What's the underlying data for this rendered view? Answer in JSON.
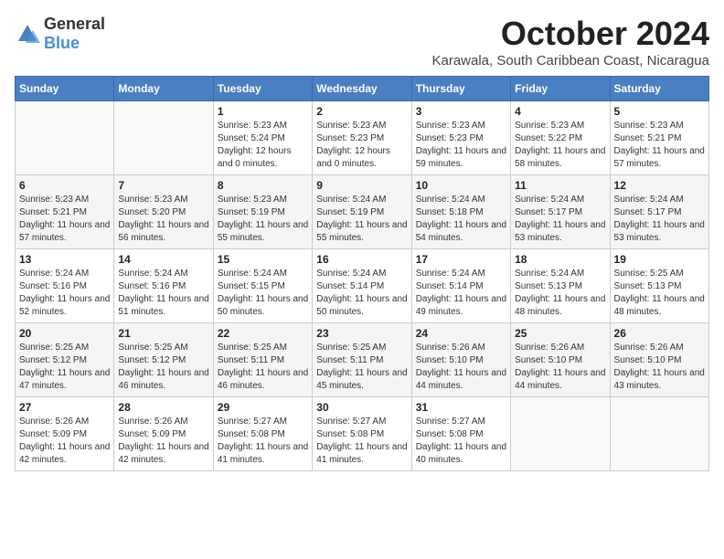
{
  "logo": {
    "general": "General",
    "blue": "Blue"
  },
  "title": "October 2024",
  "location": "Karawala, South Caribbean Coast, Nicaragua",
  "weekdays": [
    "Sunday",
    "Monday",
    "Tuesday",
    "Wednesday",
    "Thursday",
    "Friday",
    "Saturday"
  ],
  "weeks": [
    [
      {
        "day": "",
        "sunrise": "",
        "sunset": "",
        "daylight": ""
      },
      {
        "day": "",
        "sunrise": "",
        "sunset": "",
        "daylight": ""
      },
      {
        "day": "1",
        "sunrise": "Sunrise: 5:23 AM",
        "sunset": "Sunset: 5:24 PM",
        "daylight": "Daylight: 12 hours and 0 minutes."
      },
      {
        "day": "2",
        "sunrise": "Sunrise: 5:23 AM",
        "sunset": "Sunset: 5:23 PM",
        "daylight": "Daylight: 12 hours and 0 minutes."
      },
      {
        "day": "3",
        "sunrise": "Sunrise: 5:23 AM",
        "sunset": "Sunset: 5:23 PM",
        "daylight": "Daylight: 11 hours and 59 minutes."
      },
      {
        "day": "4",
        "sunrise": "Sunrise: 5:23 AM",
        "sunset": "Sunset: 5:22 PM",
        "daylight": "Daylight: 11 hours and 58 minutes."
      },
      {
        "day": "5",
        "sunrise": "Sunrise: 5:23 AM",
        "sunset": "Sunset: 5:21 PM",
        "daylight": "Daylight: 11 hours and 57 minutes."
      }
    ],
    [
      {
        "day": "6",
        "sunrise": "Sunrise: 5:23 AM",
        "sunset": "Sunset: 5:21 PM",
        "daylight": "Daylight: 11 hours and 57 minutes."
      },
      {
        "day": "7",
        "sunrise": "Sunrise: 5:23 AM",
        "sunset": "Sunset: 5:20 PM",
        "daylight": "Daylight: 11 hours and 56 minutes."
      },
      {
        "day": "8",
        "sunrise": "Sunrise: 5:23 AM",
        "sunset": "Sunset: 5:19 PM",
        "daylight": "Daylight: 11 hours and 55 minutes."
      },
      {
        "day": "9",
        "sunrise": "Sunrise: 5:24 AM",
        "sunset": "Sunset: 5:19 PM",
        "daylight": "Daylight: 11 hours and 55 minutes."
      },
      {
        "day": "10",
        "sunrise": "Sunrise: 5:24 AM",
        "sunset": "Sunset: 5:18 PM",
        "daylight": "Daylight: 11 hours and 54 minutes."
      },
      {
        "day": "11",
        "sunrise": "Sunrise: 5:24 AM",
        "sunset": "Sunset: 5:17 PM",
        "daylight": "Daylight: 11 hours and 53 minutes."
      },
      {
        "day": "12",
        "sunrise": "Sunrise: 5:24 AM",
        "sunset": "Sunset: 5:17 PM",
        "daylight": "Daylight: 11 hours and 53 minutes."
      }
    ],
    [
      {
        "day": "13",
        "sunrise": "Sunrise: 5:24 AM",
        "sunset": "Sunset: 5:16 PM",
        "daylight": "Daylight: 11 hours and 52 minutes."
      },
      {
        "day": "14",
        "sunrise": "Sunrise: 5:24 AM",
        "sunset": "Sunset: 5:16 PM",
        "daylight": "Daylight: 11 hours and 51 minutes."
      },
      {
        "day": "15",
        "sunrise": "Sunrise: 5:24 AM",
        "sunset": "Sunset: 5:15 PM",
        "daylight": "Daylight: 11 hours and 50 minutes."
      },
      {
        "day": "16",
        "sunrise": "Sunrise: 5:24 AM",
        "sunset": "Sunset: 5:14 PM",
        "daylight": "Daylight: 11 hours and 50 minutes."
      },
      {
        "day": "17",
        "sunrise": "Sunrise: 5:24 AM",
        "sunset": "Sunset: 5:14 PM",
        "daylight": "Daylight: 11 hours and 49 minutes."
      },
      {
        "day": "18",
        "sunrise": "Sunrise: 5:24 AM",
        "sunset": "Sunset: 5:13 PM",
        "daylight": "Daylight: 11 hours and 48 minutes."
      },
      {
        "day": "19",
        "sunrise": "Sunrise: 5:25 AM",
        "sunset": "Sunset: 5:13 PM",
        "daylight": "Daylight: 11 hours and 48 minutes."
      }
    ],
    [
      {
        "day": "20",
        "sunrise": "Sunrise: 5:25 AM",
        "sunset": "Sunset: 5:12 PM",
        "daylight": "Daylight: 11 hours and 47 minutes."
      },
      {
        "day": "21",
        "sunrise": "Sunrise: 5:25 AM",
        "sunset": "Sunset: 5:12 PM",
        "daylight": "Daylight: 11 hours and 46 minutes."
      },
      {
        "day": "22",
        "sunrise": "Sunrise: 5:25 AM",
        "sunset": "Sunset: 5:11 PM",
        "daylight": "Daylight: 11 hours and 46 minutes."
      },
      {
        "day": "23",
        "sunrise": "Sunrise: 5:25 AM",
        "sunset": "Sunset: 5:11 PM",
        "daylight": "Daylight: 11 hours and 45 minutes."
      },
      {
        "day": "24",
        "sunrise": "Sunrise: 5:26 AM",
        "sunset": "Sunset: 5:10 PM",
        "daylight": "Daylight: 11 hours and 44 minutes."
      },
      {
        "day": "25",
        "sunrise": "Sunrise: 5:26 AM",
        "sunset": "Sunset: 5:10 PM",
        "daylight": "Daylight: 11 hours and 44 minutes."
      },
      {
        "day": "26",
        "sunrise": "Sunrise: 5:26 AM",
        "sunset": "Sunset: 5:10 PM",
        "daylight": "Daylight: 11 hours and 43 minutes."
      }
    ],
    [
      {
        "day": "27",
        "sunrise": "Sunrise: 5:26 AM",
        "sunset": "Sunset: 5:09 PM",
        "daylight": "Daylight: 11 hours and 42 minutes."
      },
      {
        "day": "28",
        "sunrise": "Sunrise: 5:26 AM",
        "sunset": "Sunset: 5:09 PM",
        "daylight": "Daylight: 11 hours and 42 minutes."
      },
      {
        "day": "29",
        "sunrise": "Sunrise: 5:27 AM",
        "sunset": "Sunset: 5:08 PM",
        "daylight": "Daylight: 11 hours and 41 minutes."
      },
      {
        "day": "30",
        "sunrise": "Sunrise: 5:27 AM",
        "sunset": "Sunset: 5:08 PM",
        "daylight": "Daylight: 11 hours and 41 minutes."
      },
      {
        "day": "31",
        "sunrise": "Sunrise: 5:27 AM",
        "sunset": "Sunset: 5:08 PM",
        "daylight": "Daylight: 11 hours and 40 minutes."
      },
      {
        "day": "",
        "sunrise": "",
        "sunset": "",
        "daylight": ""
      },
      {
        "day": "",
        "sunrise": "",
        "sunset": "",
        "daylight": ""
      }
    ]
  ]
}
